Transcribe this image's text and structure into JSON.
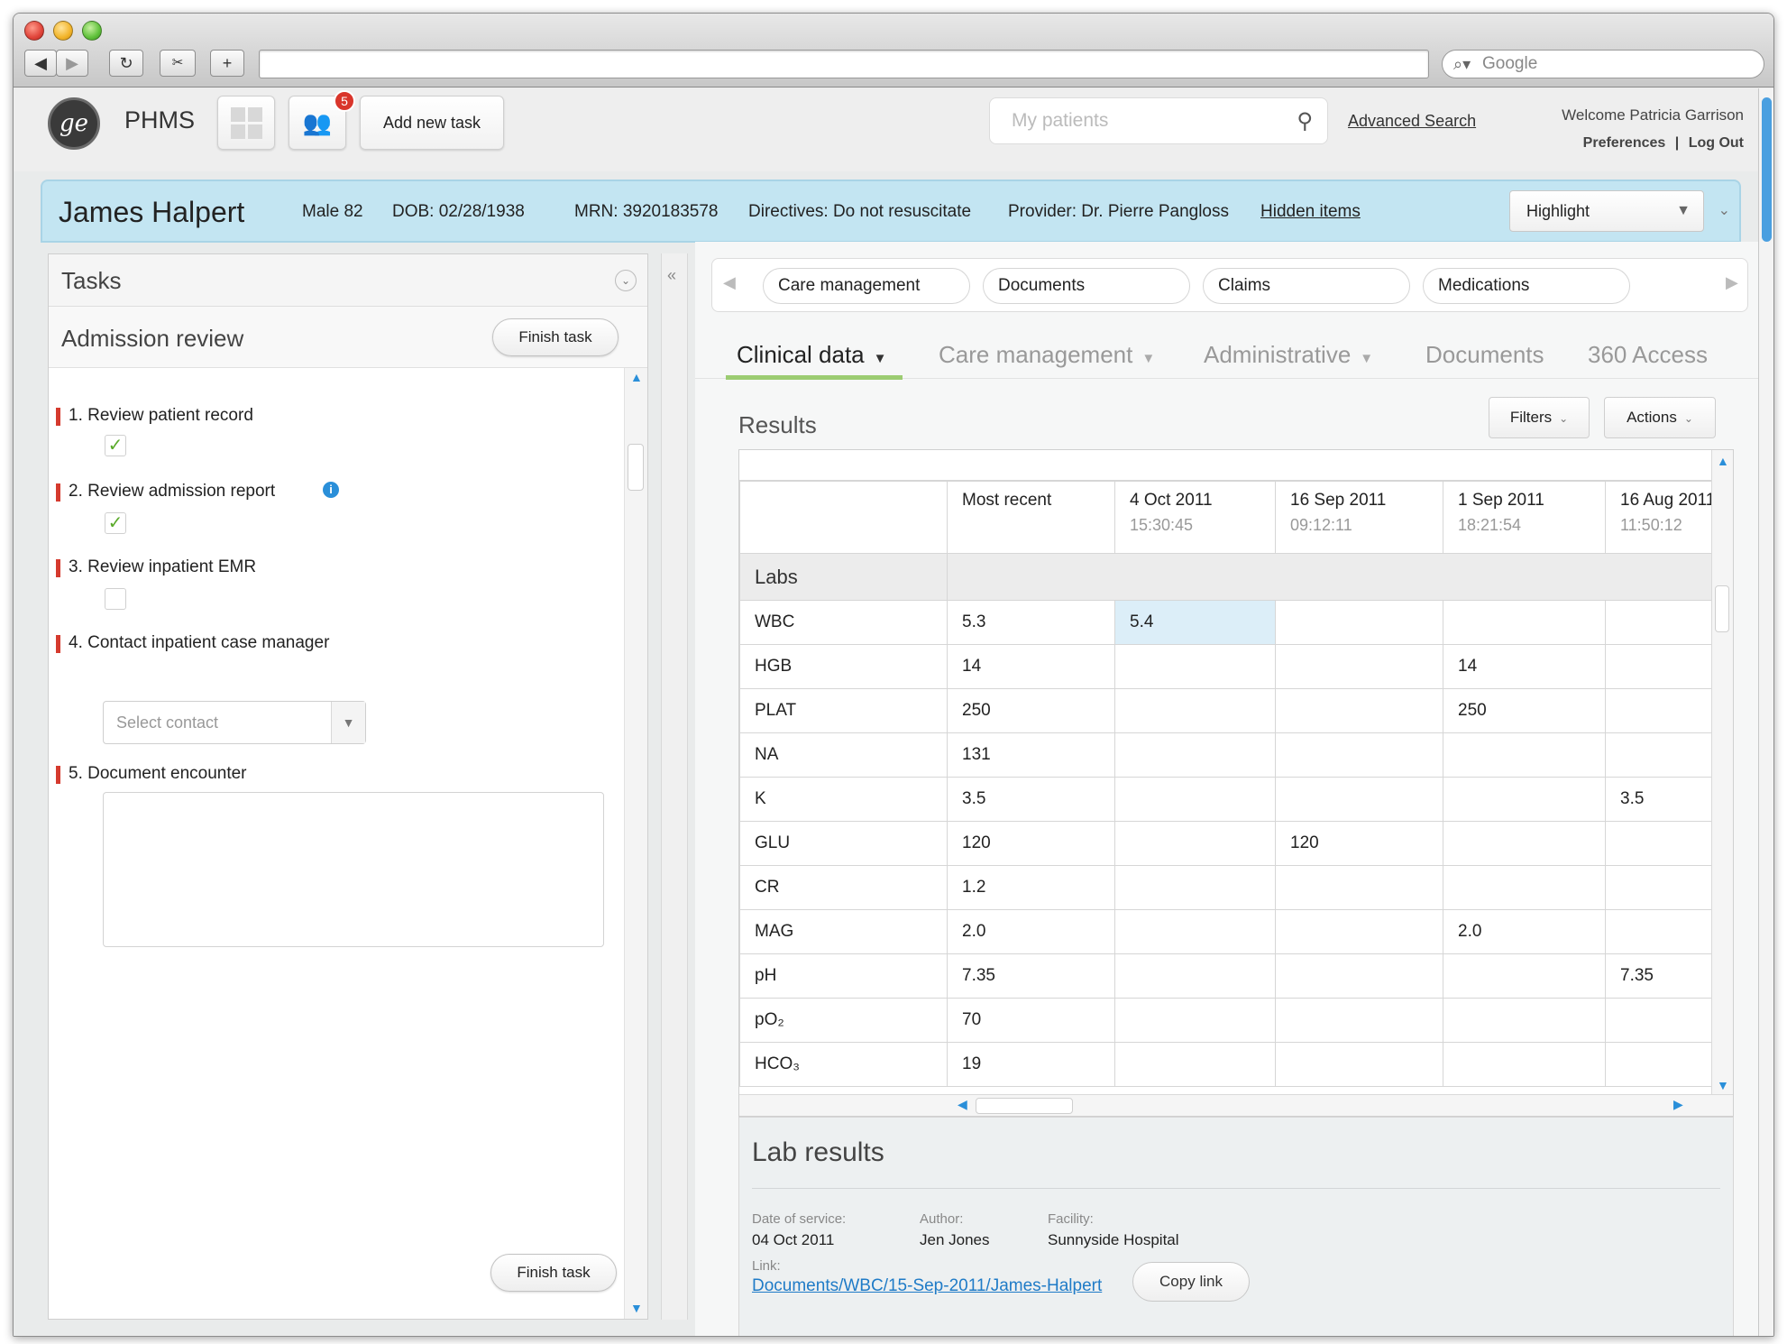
{
  "browser": {
    "search_placeholder": "Google"
  },
  "app": {
    "brand": "PHMS",
    "logo_text": "ge",
    "notification_count": "5",
    "add_task_label": "Add new task",
    "my_patients_placeholder": "My patients",
    "advanced_search": "Advanced Search",
    "welcome": "Welcome Patricia Garrison",
    "preferences": "Preferences",
    "separator": "|",
    "logout": "Log Out"
  },
  "patient": {
    "name": "James Halpert",
    "sex_age": "Male 82",
    "dob": "DOB: 02/28/1938",
    "mrn": "MRN: 3920183578",
    "directives": "Directives: Do not resuscitate",
    "provider": "Provider: Dr. Pierre Pangloss",
    "hidden_items": "Hidden items",
    "highlight_label": "Highlight"
  },
  "tasks": {
    "title": "Tasks",
    "task_name": "Admission review",
    "finish_label": "Finish task",
    "steps": [
      {
        "label": "1. Review patient record",
        "checked": true
      },
      {
        "label": "2. Review admission report",
        "checked": true
      },
      {
        "label": "3. Review inpatient EMR",
        "checked": false
      },
      {
        "label": "4. Contact inpatient case manager"
      },
      {
        "label": "5. Document encounter"
      }
    ],
    "select_contact_placeholder": "Select contact"
  },
  "quick_tabs": [
    "Care management",
    "Documents",
    "Claims",
    "Medications"
  ],
  "main_tabs": [
    {
      "label": "Clinical data",
      "active": true,
      "dropdown": true
    },
    {
      "label": "Care management",
      "active": false,
      "dropdown": true
    },
    {
      "label": "Administrative",
      "active": false,
      "dropdown": true
    },
    {
      "label": "Documents",
      "active": false,
      "dropdown": false
    },
    {
      "label": "360 Access",
      "active": false,
      "dropdown": false
    }
  ],
  "results": {
    "title": "Results",
    "filters_label": "Filters",
    "actions_label": "Actions",
    "columns": [
      {
        "date": "Most recent",
        "time": ""
      },
      {
        "date": "4 Oct 2011",
        "time": "15:30:45"
      },
      {
        "date": "16 Sep 2011",
        "time": "09:12:11"
      },
      {
        "date": "1 Sep 2011",
        "time": "18:21:54"
      },
      {
        "date": "16 Aug 2011",
        "time": "11:50:12"
      }
    ],
    "section": "Labs",
    "rows": [
      {
        "name": "WBC",
        "values": [
          "5.3",
          "5.4",
          "",
          "",
          ""
        ]
      },
      {
        "name": "HGB",
        "values": [
          "14",
          "",
          "",
          "14",
          ""
        ]
      },
      {
        "name": "PLAT",
        "values": [
          "250",
          "",
          "",
          "250",
          ""
        ]
      },
      {
        "name": "NA",
        "values": [
          "131",
          "",
          "",
          "",
          ""
        ]
      },
      {
        "name": "K",
        "values": [
          "3.5",
          "",
          "",
          "",
          "3.5"
        ]
      },
      {
        "name": "GLU",
        "values": [
          "120",
          "",
          "120",
          "",
          ""
        ]
      },
      {
        "name": "CR",
        "values": [
          "1.2",
          "",
          "",
          "",
          ""
        ]
      },
      {
        "name": "MAG",
        "values": [
          "2.0",
          "",
          "",
          "2.0",
          ""
        ]
      },
      {
        "name": "pH",
        "values": [
          "7.35",
          "",
          "",
          "",
          "7.35"
        ]
      },
      {
        "name": "pO₂",
        "values": [
          "70",
          "",
          "",
          "",
          ""
        ]
      },
      {
        "name": "HCO₃",
        "values": [
          "19",
          "",
          "",
          "",
          ""
        ]
      }
    ]
  },
  "lab_results": {
    "title": "Lab results",
    "date_label": "Date of service:",
    "date_value": "04 Oct 2011",
    "author_label": "Author:",
    "author_value": "Jen Jones",
    "facility_label": "Facility:",
    "facility_value": "Sunnyside Hospital",
    "link_label": "Link:",
    "link_value": "Documents/WBC/15-Sep-2011/James-Halpert",
    "copy_label": "Copy link"
  },
  "colors": {
    "banner": "#c3e5f2",
    "accent_underline": "#9ccc72",
    "step_marker": "#d53a2e",
    "link": "#1f7bc7",
    "highlight_cell": "#dceef8"
  }
}
